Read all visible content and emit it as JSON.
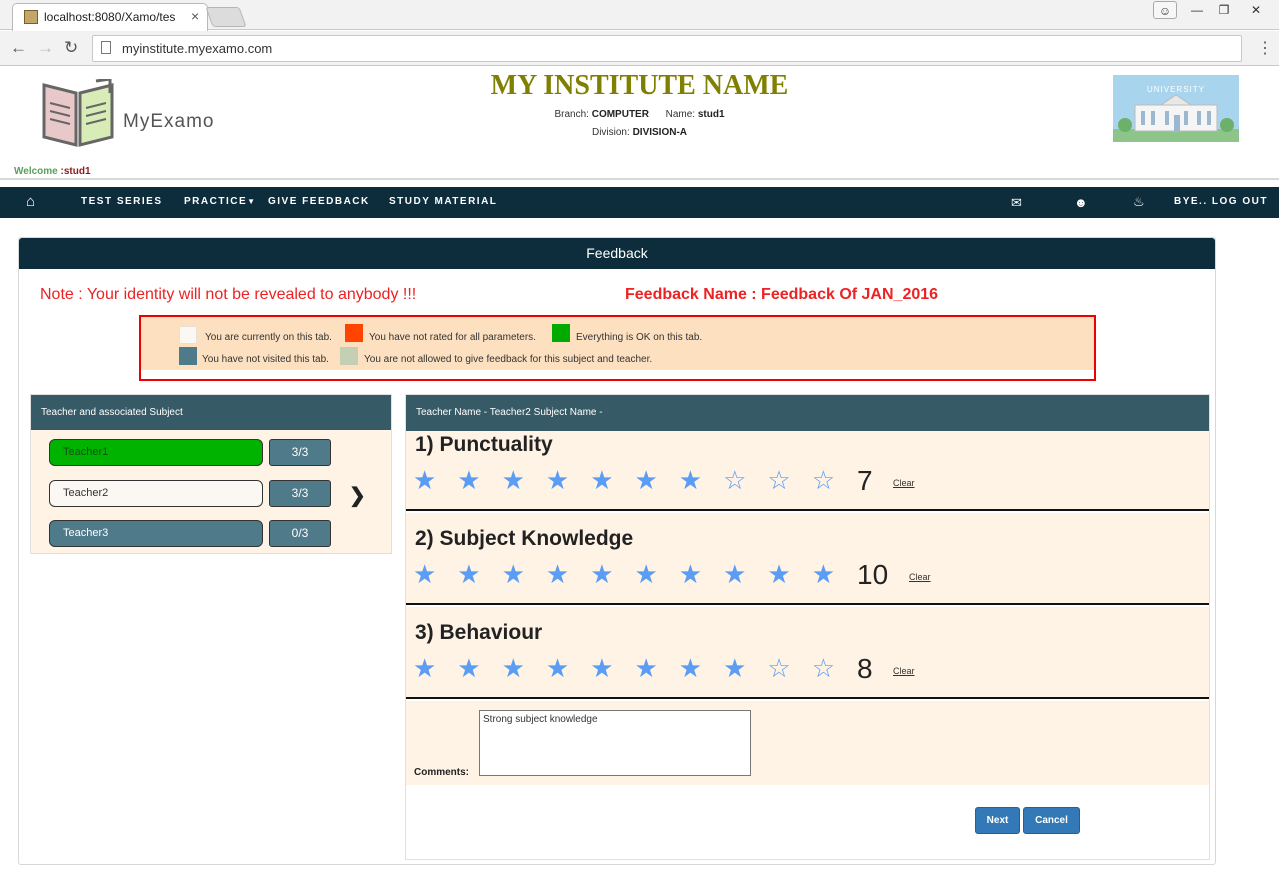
{
  "browser": {
    "tab_title": "localhost:8080/Xamo/tes",
    "tab_close": "×",
    "url": "myinstitute.myexamo.com"
  },
  "header": {
    "logo_text": "MyExamo",
    "institute_name": "MY INSTITUTE NAME",
    "branch_label": "Branch:",
    "branch_value": "COMPUTER",
    "name_label": "Name:",
    "name_value": "stud1",
    "division_label": "Division:",
    "division_value": "DIVISION-A",
    "university_label": "UNIVERSITY",
    "welcome_label": "Welcome",
    "welcome_user": ":stud1"
  },
  "nav": {
    "test_series": "TEST SERIES",
    "practice": "PRACTICE",
    "give_feedback": "GIVE FEEDBACK",
    "study_material": "STUDY MATERIAL",
    "logout": "BYE.. LOG OUT"
  },
  "feedback": {
    "title": "Feedback",
    "note": "Note : Your identity will not be revealed to anybody !!!",
    "feedback_name": "Feedback Name : Feedback Of JAN_2016",
    "legend": [
      {
        "color": "#fbf8f4",
        "text": "You are currently on this tab."
      },
      {
        "color": "#ff4400",
        "text": "You have not rated for all parameters."
      },
      {
        "color": "#00aa00",
        "text": "Everything is OK on this tab."
      },
      {
        "color": "#4e7a8a",
        "text": "You have not visited this tab."
      },
      {
        "color": "#c4cfb3",
        "text": "You are not allowed to give feedback for this subject and teacher."
      }
    ],
    "left_panel_title": "Teacher and associated Subject",
    "teachers": [
      {
        "name": "Teacher1",
        "count": "3/3",
        "color": "#00b300"
      },
      {
        "name": "Teacher2",
        "count": "3/3",
        "color": "#fbf8f4"
      },
      {
        "name": "Teacher3",
        "count": "0/3",
        "color": "#4e7a8a"
      }
    ],
    "right_panel_title": "Teacher Name - Teacher2   Subject Name -",
    "parameters": [
      {
        "title": "1) Punctuality",
        "rating": 7,
        "max": 10,
        "score": "7",
        "clear": "Clear"
      },
      {
        "title": "2) Subject Knowledge",
        "rating": 10,
        "max": 10,
        "score": "10",
        "clear": "Clear"
      },
      {
        "title": "3) Behaviour",
        "rating": 8,
        "max": 10,
        "score": "8",
        "clear": "Clear"
      }
    ],
    "comments_label": "Comments:",
    "comments_value": "Strong subject knowledge",
    "next_label": "Next",
    "cancel_label": "Cancel"
  }
}
